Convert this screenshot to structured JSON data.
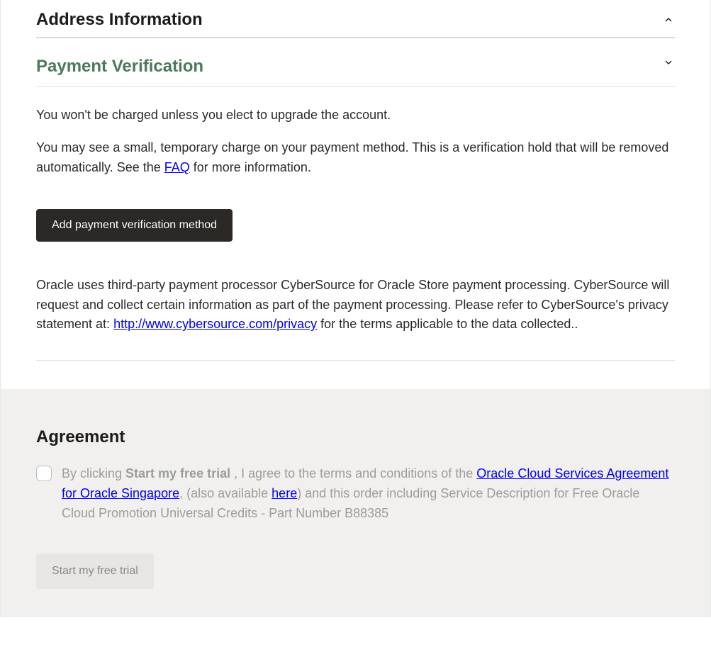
{
  "sections": {
    "address": {
      "title": "Address Information"
    },
    "payment": {
      "title": "Payment Verification",
      "p1": "You won't be charged unless you elect to upgrade the account.",
      "p2_a": "You may see a small, temporary charge on your payment method. This is a verification hold that will be removed automatically. See the ",
      "p2_link": "FAQ",
      "p2_b": " for more information.",
      "button": "Add payment verification method",
      "disclosure_a": "Oracle uses third-party payment processor CyberSource for Oracle Store payment processing. CyberSource will request and collect certain information as part of the payment processing. Please refer to CyberSource's privacy statement at: ",
      "disclosure_link": "http://www.cybersource.com/privacy",
      "disclosure_b": " for the terms applicable to the data collected.."
    }
  },
  "agreement": {
    "title": "Agreement",
    "text_a": "By clicking ",
    "text_strong": "Start my free trial",
    "text_b": " , I agree to the terms and conditions of the ",
    "link1": "Oracle Cloud Services Agreement for Oracle Singapore",
    "text_c": ", (also available ",
    "link2": "here",
    "text_d": ") and this order including Service Description for Free Oracle Cloud Promotion Universal Credits - Part Number B88385",
    "button": "Start my free trial"
  }
}
